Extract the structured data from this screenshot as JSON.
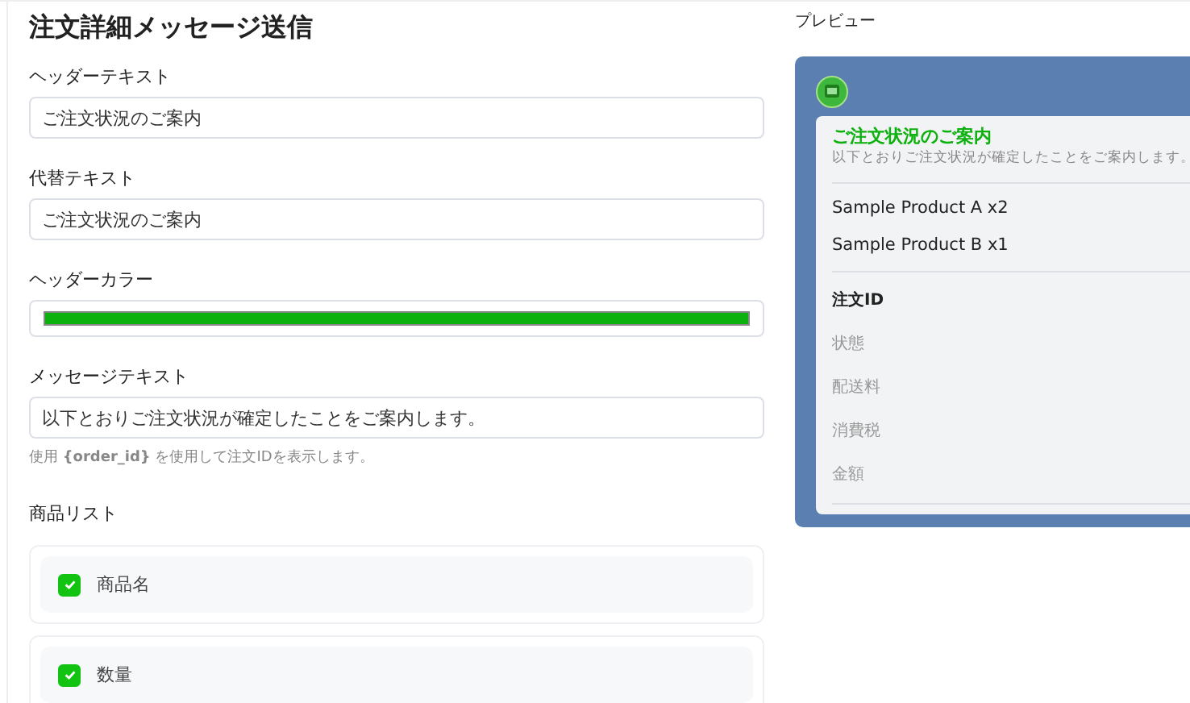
{
  "title": "注文詳細メッセージ送信",
  "fields": [
    {
      "label": "ヘッダーテキスト",
      "value": "ご注文状況のご案内"
    },
    {
      "label": "代替テキスト",
      "value": "ご注文状況のご案内"
    }
  ],
  "header_color": {
    "label": "ヘッダーカラー",
    "color": "#0db10d"
  },
  "message": {
    "label": "メッセージテキスト",
    "value": "以下とおりご注文状況が確定したことをご案内します。",
    "hint": "使用 **{order_id}** を使用して注文IDを表示します。"
  },
  "product_list": {
    "label": "商品リスト",
    "items": [
      {
        "label": "商品名",
        "checked": true
      },
      {
        "label": "数量",
        "checked": true
      }
    ]
  },
  "preview": {
    "label": "プレビュー",
    "header": "ご注文状況のご案内",
    "message": "以下とおりご注文状況が確定したことをご案内します。",
    "products": [
      "Sample Product A x2",
      "Sample Product B x1"
    ],
    "details": [
      {
        "label": "注文ID",
        "emphasized": true
      },
      {
        "label": "状態",
        "emphasized": false
      },
      {
        "label": "配送料",
        "emphasized": false
      },
      {
        "label": "消費税",
        "emphasized": false
      },
      {
        "label": "金額",
        "emphasized": false
      }
    ]
  }
}
